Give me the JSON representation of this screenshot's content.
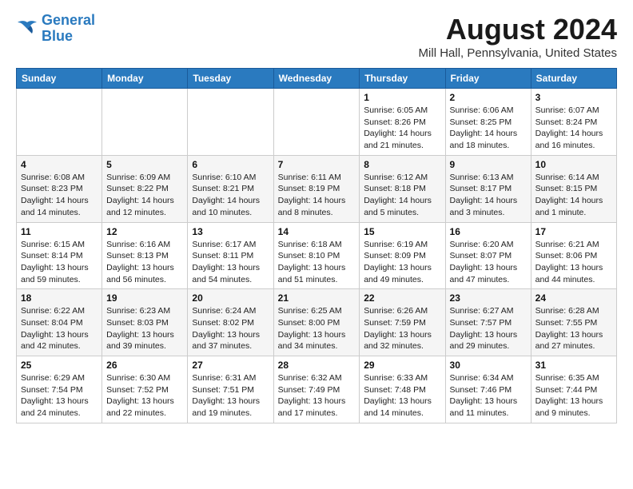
{
  "logo": {
    "line1": "General",
    "line2": "Blue"
  },
  "title": "August 2024",
  "subtitle": "Mill Hall, Pennsylvania, United States",
  "header_days": [
    "Sunday",
    "Monday",
    "Tuesday",
    "Wednesday",
    "Thursday",
    "Friday",
    "Saturday"
  ],
  "weeks": [
    [
      {
        "day": "",
        "info": ""
      },
      {
        "day": "",
        "info": ""
      },
      {
        "day": "",
        "info": ""
      },
      {
        "day": "",
        "info": ""
      },
      {
        "day": "1",
        "info": "Sunrise: 6:05 AM\nSunset: 8:26 PM\nDaylight: 14 hours\nand 21 minutes."
      },
      {
        "day": "2",
        "info": "Sunrise: 6:06 AM\nSunset: 8:25 PM\nDaylight: 14 hours\nand 18 minutes."
      },
      {
        "day": "3",
        "info": "Sunrise: 6:07 AM\nSunset: 8:24 PM\nDaylight: 14 hours\nand 16 minutes."
      }
    ],
    [
      {
        "day": "4",
        "info": "Sunrise: 6:08 AM\nSunset: 8:23 PM\nDaylight: 14 hours\nand 14 minutes."
      },
      {
        "day": "5",
        "info": "Sunrise: 6:09 AM\nSunset: 8:22 PM\nDaylight: 14 hours\nand 12 minutes."
      },
      {
        "day": "6",
        "info": "Sunrise: 6:10 AM\nSunset: 8:21 PM\nDaylight: 14 hours\nand 10 minutes."
      },
      {
        "day": "7",
        "info": "Sunrise: 6:11 AM\nSunset: 8:19 PM\nDaylight: 14 hours\nand 8 minutes."
      },
      {
        "day": "8",
        "info": "Sunrise: 6:12 AM\nSunset: 8:18 PM\nDaylight: 14 hours\nand 5 minutes."
      },
      {
        "day": "9",
        "info": "Sunrise: 6:13 AM\nSunset: 8:17 PM\nDaylight: 14 hours\nand 3 minutes."
      },
      {
        "day": "10",
        "info": "Sunrise: 6:14 AM\nSunset: 8:15 PM\nDaylight: 14 hours\nand 1 minute."
      }
    ],
    [
      {
        "day": "11",
        "info": "Sunrise: 6:15 AM\nSunset: 8:14 PM\nDaylight: 13 hours\nand 59 minutes."
      },
      {
        "day": "12",
        "info": "Sunrise: 6:16 AM\nSunset: 8:13 PM\nDaylight: 13 hours\nand 56 minutes."
      },
      {
        "day": "13",
        "info": "Sunrise: 6:17 AM\nSunset: 8:11 PM\nDaylight: 13 hours\nand 54 minutes."
      },
      {
        "day": "14",
        "info": "Sunrise: 6:18 AM\nSunset: 8:10 PM\nDaylight: 13 hours\nand 51 minutes."
      },
      {
        "day": "15",
        "info": "Sunrise: 6:19 AM\nSunset: 8:09 PM\nDaylight: 13 hours\nand 49 minutes."
      },
      {
        "day": "16",
        "info": "Sunrise: 6:20 AM\nSunset: 8:07 PM\nDaylight: 13 hours\nand 47 minutes."
      },
      {
        "day": "17",
        "info": "Sunrise: 6:21 AM\nSunset: 8:06 PM\nDaylight: 13 hours\nand 44 minutes."
      }
    ],
    [
      {
        "day": "18",
        "info": "Sunrise: 6:22 AM\nSunset: 8:04 PM\nDaylight: 13 hours\nand 42 minutes."
      },
      {
        "day": "19",
        "info": "Sunrise: 6:23 AM\nSunset: 8:03 PM\nDaylight: 13 hours\nand 39 minutes."
      },
      {
        "day": "20",
        "info": "Sunrise: 6:24 AM\nSunset: 8:02 PM\nDaylight: 13 hours\nand 37 minutes."
      },
      {
        "day": "21",
        "info": "Sunrise: 6:25 AM\nSunset: 8:00 PM\nDaylight: 13 hours\nand 34 minutes."
      },
      {
        "day": "22",
        "info": "Sunrise: 6:26 AM\nSunset: 7:59 PM\nDaylight: 13 hours\nand 32 minutes."
      },
      {
        "day": "23",
        "info": "Sunrise: 6:27 AM\nSunset: 7:57 PM\nDaylight: 13 hours\nand 29 minutes."
      },
      {
        "day": "24",
        "info": "Sunrise: 6:28 AM\nSunset: 7:55 PM\nDaylight: 13 hours\nand 27 minutes."
      }
    ],
    [
      {
        "day": "25",
        "info": "Sunrise: 6:29 AM\nSunset: 7:54 PM\nDaylight: 13 hours\nand 24 minutes."
      },
      {
        "day": "26",
        "info": "Sunrise: 6:30 AM\nSunset: 7:52 PM\nDaylight: 13 hours\nand 22 minutes."
      },
      {
        "day": "27",
        "info": "Sunrise: 6:31 AM\nSunset: 7:51 PM\nDaylight: 13 hours\nand 19 minutes."
      },
      {
        "day": "28",
        "info": "Sunrise: 6:32 AM\nSunset: 7:49 PM\nDaylight: 13 hours\nand 17 minutes."
      },
      {
        "day": "29",
        "info": "Sunrise: 6:33 AM\nSunset: 7:48 PM\nDaylight: 13 hours\nand 14 minutes."
      },
      {
        "day": "30",
        "info": "Sunrise: 6:34 AM\nSunset: 7:46 PM\nDaylight: 13 hours\nand 11 minutes."
      },
      {
        "day": "31",
        "info": "Sunrise: 6:35 AM\nSunset: 7:44 PM\nDaylight: 13 hours\nand 9 minutes."
      }
    ]
  ]
}
